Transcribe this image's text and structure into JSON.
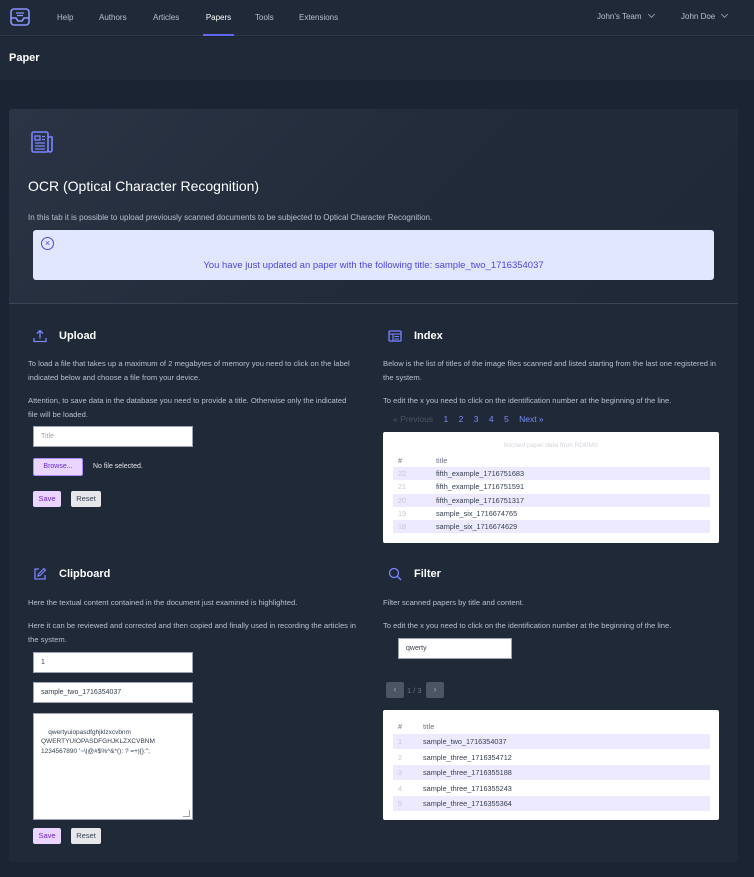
{
  "nav": {
    "items": [
      "Help",
      "Authors",
      "Articles",
      "Papers",
      "Tools",
      "Extensions"
    ],
    "team": "John's Team",
    "user": "John Doe"
  },
  "page": {
    "title": "Paper"
  },
  "hero": {
    "title": "OCR (Optical Character Recognition)",
    "description": "In this tab it is possible to upload previously scanned documents to be subjected to Optical Character Recognition.",
    "alert": "You have just updated an paper with the following title: sample_two_1716354037"
  },
  "upload": {
    "title": "Upload",
    "p1": "To load a file that takes up a maximum of 2 megabytes of memory you need to click on the label indicated below and choose a file from your device.",
    "p2": "Attention, to save data in the database you need to provide a title. Otherwise only the indicated file will be loaded.",
    "title_placeholder": "Title",
    "browse_label": "Browse...",
    "file_status": "No file selected.",
    "save_label": "Save",
    "reset_label": "Reset"
  },
  "index": {
    "title": "Index",
    "p1": "Below is the list of titles of the image files scanned and listed starting from the last one registered in the system.",
    "p2": "To edit the x you need to click on the identification number at the beginning of the line.",
    "pager": {
      "prev": "« Previous",
      "pages": [
        "1",
        "2",
        "3",
        "4",
        "5"
      ],
      "next": "Next »"
    },
    "caption": "fetched paper data from RDBMS",
    "headers": [
      "#",
      "title"
    ],
    "rows": [
      {
        "id": "22",
        "title": "fifth_example_1716751683"
      },
      {
        "id": "21",
        "title": "fifth_example_1716751591"
      },
      {
        "id": "20",
        "title": "fifth_example_1716751317"
      },
      {
        "id": "19",
        "title": "sample_six_1716674765"
      },
      {
        "id": "18",
        "title": "sample_six_1716674629"
      }
    ]
  },
  "clipboard": {
    "title": "Clipboard",
    "p1": "Here the textual content contained in the document just examined is highlighted.",
    "p2": "Here it can be reviewed and corrected and then copied and finally used in recording the articles in the system.",
    "id_value": "1",
    "title_value": "sample_two_1716354037",
    "content": "qwertyuiopasdfghjklzxcvbnm\nQWERTYUIOPASDFGHJKLZXCVBNM\n1234567890 '~\\|@#$%^&*(): ? =+|{}:\";",
    "save_label": "Save",
    "reset_label": "Reset"
  },
  "filter": {
    "title": "Filter",
    "p1": "Filter scanned papers by title and content.",
    "p2": "To edit the x you need to click on the identification number at the beginning of the line.",
    "search_value": "qwerty",
    "page_info": "1 / 3",
    "headers": [
      "#",
      "title"
    ],
    "rows": [
      {
        "id": "1",
        "title": "sample_two_1716354037"
      },
      {
        "id": "2",
        "title": "sample_three_1716354712"
      },
      {
        "id": "3",
        "title": "sample_three_1716355188"
      },
      {
        "id": "4",
        "title": "sample_three_1716355243"
      },
      {
        "id": "5",
        "title": "sample_three_1716355364"
      }
    ]
  }
}
